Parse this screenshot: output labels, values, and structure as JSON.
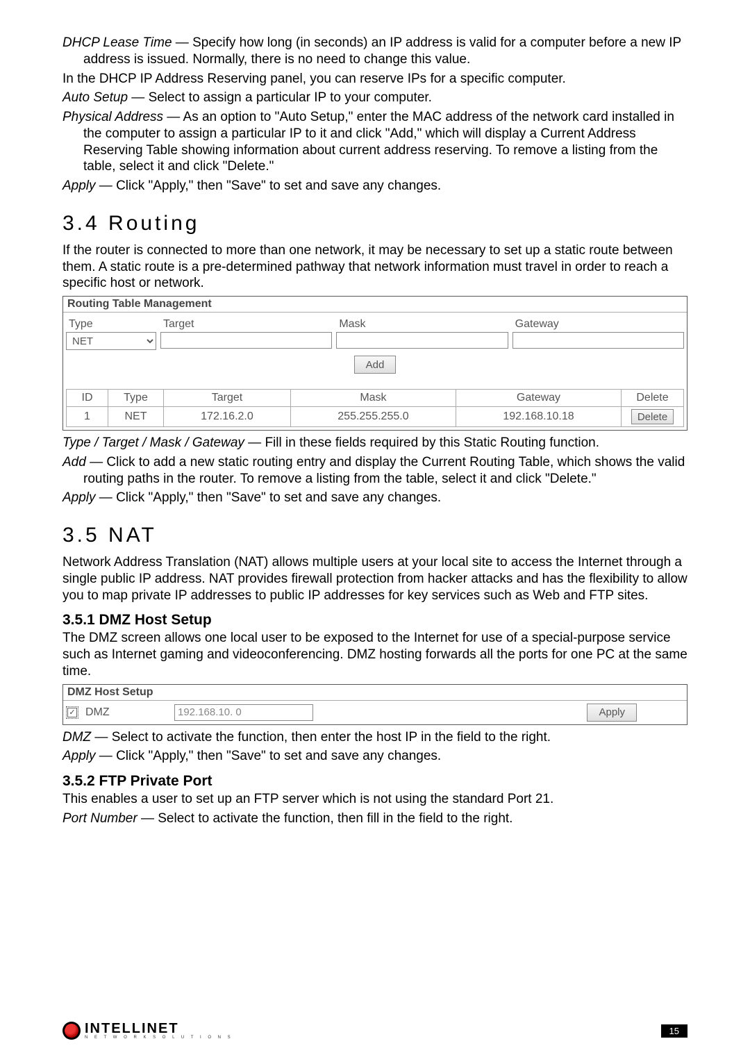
{
  "intro": {
    "dhcp_lease_label": "DHCP Lease Time",
    "dhcp_lease_text": " — Specify how long (in seconds) an IP address is valid for a computer before a new IP address is issued. Normally, there is no need to change this value.",
    "reserving_intro": "In the DHCP IP Address Reserving panel, you can reserve IPs for a specific computer.",
    "auto_setup_label": "Auto Setup",
    "auto_setup_text": " — Select to assign a particular IP to your computer.",
    "phys_addr_label": "Physical Address",
    "phys_addr_text": " — As an option to \"Auto Setup,\" enter the MAC address of the network card installed in the computer to assign a particular IP to it and click \"Add,\" which will display a Current Address Reserving Table showing information about current address reserving. To remove a listing from the table, select it and click \"Delete.\"",
    "apply_label": "Apply",
    "apply_text": " — Click \"Apply,\" then \"Save\" to set and save any changes."
  },
  "routing": {
    "heading": "3.4  Routing",
    "intro": "If the router is connected to more than one network, it may be necessary to set up a static route between them. A static route is a pre-determined pathway that network information must travel in order to reach a specific host or network.",
    "panel_title": "Routing Table Management",
    "labels": {
      "type": "Type",
      "target": "Target",
      "mask": "Mask",
      "gateway": "Gateway"
    },
    "type_value": "NET",
    "add_btn": "Add",
    "table_headers": {
      "id": "ID",
      "type": "Type",
      "target": "Target",
      "mask": "Mask",
      "gateway": "Gateway",
      "delete": "Delete"
    },
    "rows": [
      {
        "id": "1",
        "type": "NET",
        "target": "172.16.2.0",
        "mask": "255.255.255.0",
        "gateway": "192.168.10.18",
        "delete": "Delete"
      }
    ],
    "defs": {
      "types_label": "Type / Target / Mask / Gateway",
      "types_text": " — Fill in these fields required by this Static Routing function.",
      "add_label": "Add",
      "add_text": " — Click to add a new static routing entry and display the Current Routing Table, which shows the valid routing paths in the router. To remove a listing from the table, select it and click \"Delete.\"",
      "apply_label": "Apply",
      "apply_text": " — Click \"Apply,\" then \"Save\" to set and save any changes."
    }
  },
  "nat": {
    "heading": "3.5  NAT",
    "intro": "Network Address Translation (NAT) allows multiple users at your local site to access the Internet through a single public IP address. NAT provides firewall protection from hacker attacks and has the flexibility to allow you to map private IP addresses to public IP addresses for key services such as Web and FTP sites.",
    "dmz": {
      "heading": "3.5.1  DMZ Host Setup",
      "intro": "The DMZ screen allows one local user to be exposed to the Internet for use of a special-purpose service such as Internet gaming and videoconferencing. DMZ hosting forwards all the ports for one PC at the same time.",
      "panel_title": "DMZ Host Setup",
      "chk_label": "DMZ",
      "ip_value": "192.168.10. 0",
      "apply_btn": "Apply",
      "def_dmz_label": "DMZ",
      "def_dmz_text": " — Select to activate the function, then enter the host IP in the field to the right.",
      "def_apply_label": "Apply",
      "def_apply_text": " — Click \"Apply,\" then \"Save\" to set and save any changes."
    },
    "ftp": {
      "heading": "3.5.2  FTP Private Port",
      "intro": "This enables a user to set up an FTP server which is not using the standard Port 21.",
      "def_port_label": "Port Number",
      "def_port_text": " — Select  to activate the function, then fill in the field to the right."
    }
  },
  "footer": {
    "brand": "INTELLINET",
    "tagline": "N E T W O R K   S O L U T I O N S",
    "page": "15"
  }
}
